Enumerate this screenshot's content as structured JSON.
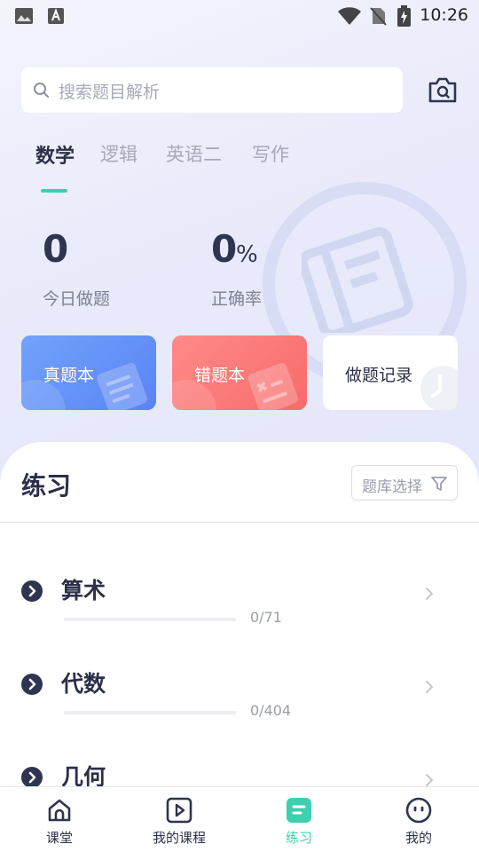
{
  "status_bar": {
    "time": "10:26"
  },
  "search": {
    "placeholder": "搜索题目解析"
  },
  "tabs": [
    {
      "label": "数学",
      "active": true
    },
    {
      "label": "逻辑",
      "active": false
    },
    {
      "label": "英语二",
      "active": false
    },
    {
      "label": "写作",
      "active": false
    }
  ],
  "stats": {
    "today_count": "0",
    "today_label": "今日做题",
    "accuracy": "0",
    "accuracy_unit": "%",
    "accuracy_label": "正确率"
  },
  "cards": {
    "real_exam": "真题本",
    "wrong_book": "错题本",
    "history": "做题记录"
  },
  "practice": {
    "title": "练习",
    "filter_label": "题库选择",
    "topics": [
      {
        "name": "算术",
        "count": "0/71",
        "progress": 0
      },
      {
        "name": "代数",
        "count": "0/404",
        "progress": 0
      },
      {
        "name": "几何",
        "count": "",
        "progress": 0
      }
    ]
  },
  "nav": {
    "items": [
      {
        "label": "课堂",
        "icon": "home-icon"
      },
      {
        "label": "我的课程",
        "icon": "video-play-icon"
      },
      {
        "label": "练习",
        "icon": "practice-icon",
        "active": true
      },
      {
        "label": "我的",
        "icon": "profile-face-icon"
      }
    ]
  },
  "colors": {
    "accent": "#3ecfb0",
    "real_card": "#6693f7",
    "wrong_card": "#f97a7a",
    "text_dark": "#2b3048"
  }
}
